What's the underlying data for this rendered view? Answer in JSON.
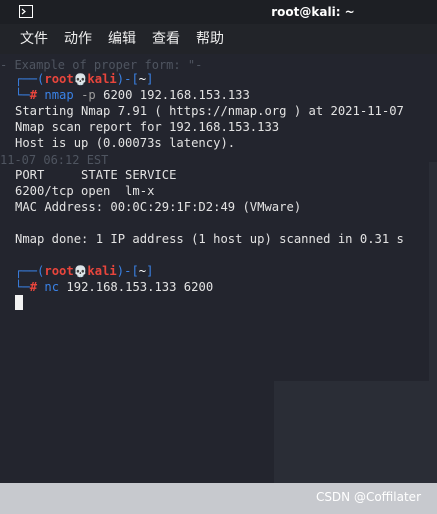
{
  "window": {
    "title": "root@kali: ~",
    "menu": [
      "文件",
      "动作",
      "编辑",
      "查看",
      "帮助"
    ]
  },
  "background_text": [
    "- Example of proper form: \"-",
    "11-07 06:12 EST"
  ],
  "terminal": {
    "prompt_user": "root",
    "prompt_skull": "💀",
    "prompt_host": "kali",
    "prompt_dir": "~",
    "session1": {
      "cmd": "nmap",
      "flag": "-p",
      "args": "6200 192.168.153.133",
      "output": [
        "Starting Nmap 7.91 ( https://nmap.org ) at 2021-11-07",
        "Nmap scan report for 192.168.153.133",
        "Host is up (0.00073s latency).",
        "",
        "PORT     STATE SERVICE",
        "6200/tcp open  lm-x",
        "MAC Address: 00:0C:29:1F:D2:49 (VMware)",
        "",
        "Nmap done: 1 IP address (1 host up) scanned in 0.31 s"
      ]
    },
    "session2": {
      "cmd": "nc",
      "args": "192.168.153.133 6200"
    }
  },
  "watermark": "CSDN @Coffilater",
  "colors": {
    "background": "#23252e",
    "prompt_blue": "#3a82e6",
    "prompt_red": "#e8453c",
    "text": "#e3e3e3"
  }
}
